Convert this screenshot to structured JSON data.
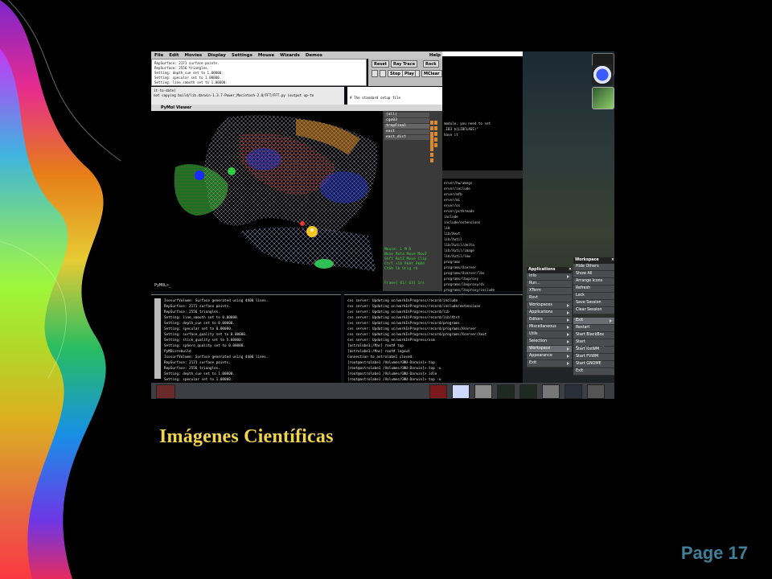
{
  "menubar": {
    "items": [
      "File",
      "Edit",
      "Movies",
      "Display",
      "Settings",
      "Mouse",
      "Wizards",
      "Demos"
    ],
    "help": "Help"
  },
  "top_console": {
    "lines": [
      "RepSurface: 2171 surface points.",
      "RepSurface: 2556 triangles.",
      "Setting: depth_cue set to 1.00000.",
      "Setting: specular set to 1.00000.",
      "Setting: line_smooth set to 1.00000."
    ]
  },
  "controls": {
    "reset": "Reset",
    "ray_trace": "Ray Trace",
    "rock": "Rock",
    "stop": "Stop",
    "play": "Play",
    "mclear": "MClear"
  },
  "term_strip": {
    "lines": [
      "it-to-date)",
      "not copying build/lib.darwin-1.3.7-Power_Macintosh-2.0/FFT/FFT.py (output up-to"
    ],
    "right_line": "# The standard setup file"
  },
  "viewer": {
    "title": "PyMol Viewer",
    "prompt": "PyMOL>_",
    "objects": [
      "(all)",
      "cgo03",
      "trepFinal",
      "east",
      "east_dist"
    ],
    "mouse_lines": [
      "Mouse: L  M  R",
      "None Rota Move MovZ",
      "Shft RotZ Move Clip",
      "Ctrl +lb  PkAt PkBd",
      "CtSh lb  Orig  rb"
    ],
    "frame": "Frame[ 61/ 63] 1/s"
  },
  "right_terminal": {
    "lines": [
      "module, you need to set",
      "",
      "",
      ".IB3 $(LIBFLAGS)\"",
      "",
      "",
      "have it",
      "",
      "erver/hw/amngs",
      "erver/include",
      "erver/mfb",
      "erver/mi",
      "erver/os",
      "erver/pcthreads",
      "",
      "include",
      "include/extensions",
      "lib",
      "lib/Xext",
      "lib/Xutil",
      "lib/Xutil/delta",
      "lib/Xutil/image",
      "lib/Xutil/low",
      "programs",
      "programs/Xserver",
      "programs/Xserver/lbx",
      "programs/lbxproxy",
      "programs/lbxproxy/di",
      "programs/lbxproxy/include",
      "programs/lbxproxy/os"
    ]
  },
  "bottom_left_terminal": {
    "lines": [
      "IsosurfVolume: Surface generated using 4400 lines.",
      "RepSurface: 2171 surface points.",
      "RepSurface: 2556 triangles.",
      "Setting: line_smooth set to 0.00000.",
      "Setting: depth_cue set to 0.00000.",
      "Setting: specular set to 0.00000.",
      "Setting: surface_quality set to 0.00000.",
      "Setting: stick_quality set to 5.00000.",
      "Setting: sphere_quality set to 0.00000.",
      "PyMOL>rebuild",
      " IsosurfVolume: Surface generated using 4400 lines.",
      " RepSurface: 2171 surface points.",
      " RepSurface: 2556 triangles.",
      " Setting: depth_cue set to 1.00000.",
      " Setting: specular set to 1.00000.",
      " Setting: line_smooth set to 1.00000.",
      " IsosurfVolume: Surface generated using 48142 lines."
    ]
  },
  "bottom_right_terminal": {
    "lines": [
      "cvs server: Updating xc/workInProgress/record/include",
      "cvs server: Updating xc/workInProgress/record/include/extensions",
      "cvs server: Updating xc/workInProgress/record/lib",
      "cvs server: Updating xc/workInProgress/record/lib/Xtst",
      "cvs server: Updating xc/workInProgress/record/programs",
      "cvs server: Updating xc/workInProgress/record/programs/Xserver",
      "cvs server: Updating xc/workInProgress/record/programs/Xserver/Xext",
      "cvs server: Updating xc/workInProgress/xsm",
      "[astrolabe1:/Mac] root# top",
      "[astrolabe1:/Mac] root# logout",
      "Connection to astrolabe1 closed.",
      "[root@astrolabe1 /Volumes/GNU-Darwin]> top",
      "[root@astrolabe1 /Volumes/GNU-Darwin]> top -u",
      "[root@astrolabe1 /Volumes/GNU-Darwin]> idle",
      "[root@astrolabe1 /Volumes/GNU-Darwin]> top -u",
      "[root@astrolabe1 /Volumes/GNU-Darwin]> exit",
      "[love@astrolabe1 /Users/love] xwd -out pymol.xwd"
    ]
  },
  "applications_menu": {
    "title": "Applications",
    "items": [
      "Info",
      "Run...",
      "XTerm",
      "Rxvt",
      "Workspaces",
      "Applications",
      "Editors",
      "Miscellaneous",
      "Utils",
      "Selection",
      "Workspace",
      "Appearance",
      "Exit"
    ]
  },
  "workspace_menu": {
    "title": "Workspace",
    "items": [
      "Hide Others",
      "Show All",
      "Arrange Icons",
      "Refresh",
      "Lock",
      "Save Session",
      "Clear Session"
    ]
  },
  "exit_menu": {
    "title": "Exit",
    "items": [
      "Restart",
      "Start BlackBox",
      "Start Enlightenment",
      "Start IceWM",
      "Start FVWM",
      "Start GNOME",
      "Exit"
    ]
  },
  "caption": "Imágenes Científicas",
  "page_label": "Page 17",
  "colors": {
    "caption": "#f2d34c",
    "page_label": "#3f7f99",
    "background": "#000000"
  }
}
